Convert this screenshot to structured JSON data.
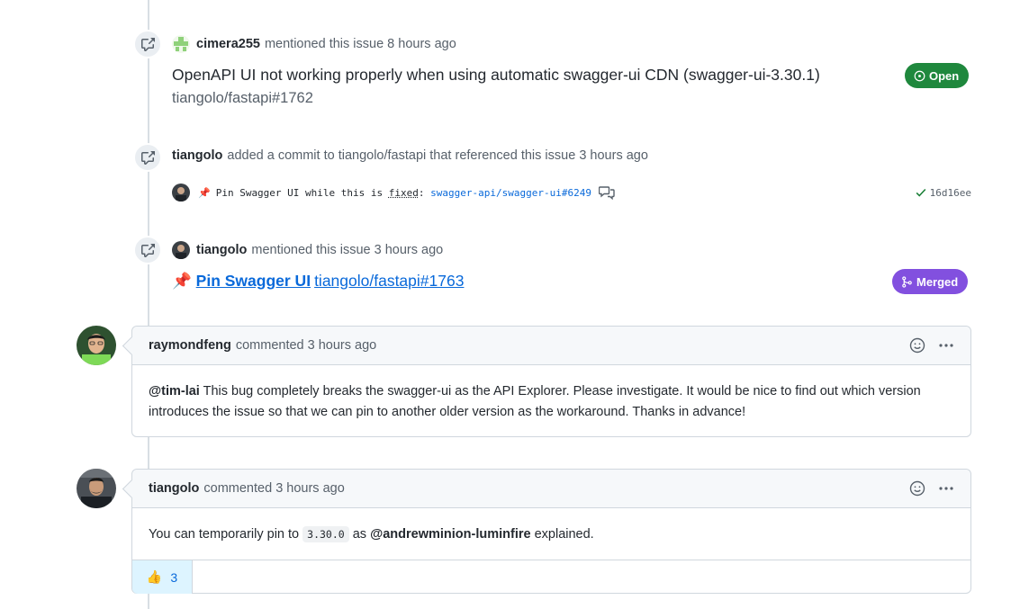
{
  "events": [
    {
      "type": "mentioned",
      "author": "cimera255",
      "action": "mentioned this issue",
      "time": "8 hours ago",
      "ref_title": "OpenAPI UI not working properly when using automatic swagger-ui CDN (swagger-ui-3.30.1)",
      "ref_repo": "tiangolo/fastapi#1762",
      "state": "Open"
    },
    {
      "type": "commit",
      "author": "tiangolo",
      "action": "added a commit to tiangolo/fastapi that referenced this issue",
      "time": "3 hours ago",
      "commit_pin": "📌",
      "commit_message_prefix": "Pin Swagger UI while this is ",
      "commit_message_fixed": "fixed",
      "commit_message_colon": ": ",
      "commit_link": "swagger-api/swagger-ui#6249",
      "commit_sha": "16d16ee"
    },
    {
      "type": "mentioned",
      "author": "tiangolo",
      "action": "mentioned this issue",
      "time": "3 hours ago",
      "pr_pin": "📌",
      "pr_title": "Pin Swagger UI",
      "pr_ref": "tiangolo/fastapi#1763",
      "state": "Merged"
    }
  ],
  "comments": [
    {
      "author": "raymondfeng",
      "action": "commented",
      "time": "3 hours ago",
      "mention": "@tim-lai",
      "body": " This bug completely breaks the swagger-ui as the API Explorer. Please investigate. It would be nice to find out which version introduces the issue so that we can pin to another older version as the workaround. Thanks in advance!"
    },
    {
      "author": "tiangolo",
      "action": "commented",
      "time": "3 hours ago",
      "body_before": "You can temporarily pin to ",
      "code": "3.30.0",
      "body_middle": " as ",
      "mention": "@andrewminion-luminfire",
      "body_after": " explained.",
      "reaction_emoji": "👍",
      "reaction_count": "3"
    }
  ],
  "icons": {
    "cross_reference": "cross-reference-icon",
    "smiley": "smiley-icon",
    "kebab": "kebab-horizontal-icon",
    "open_state": "issue-opened-icon",
    "merged_state": "git-merge-icon",
    "check": "check-icon",
    "comment": "comment-discussion-icon"
  },
  "colors": {
    "open": "#1f883d",
    "merged": "#8250df",
    "link": "#0969da",
    "check": "#1a7f37"
  }
}
